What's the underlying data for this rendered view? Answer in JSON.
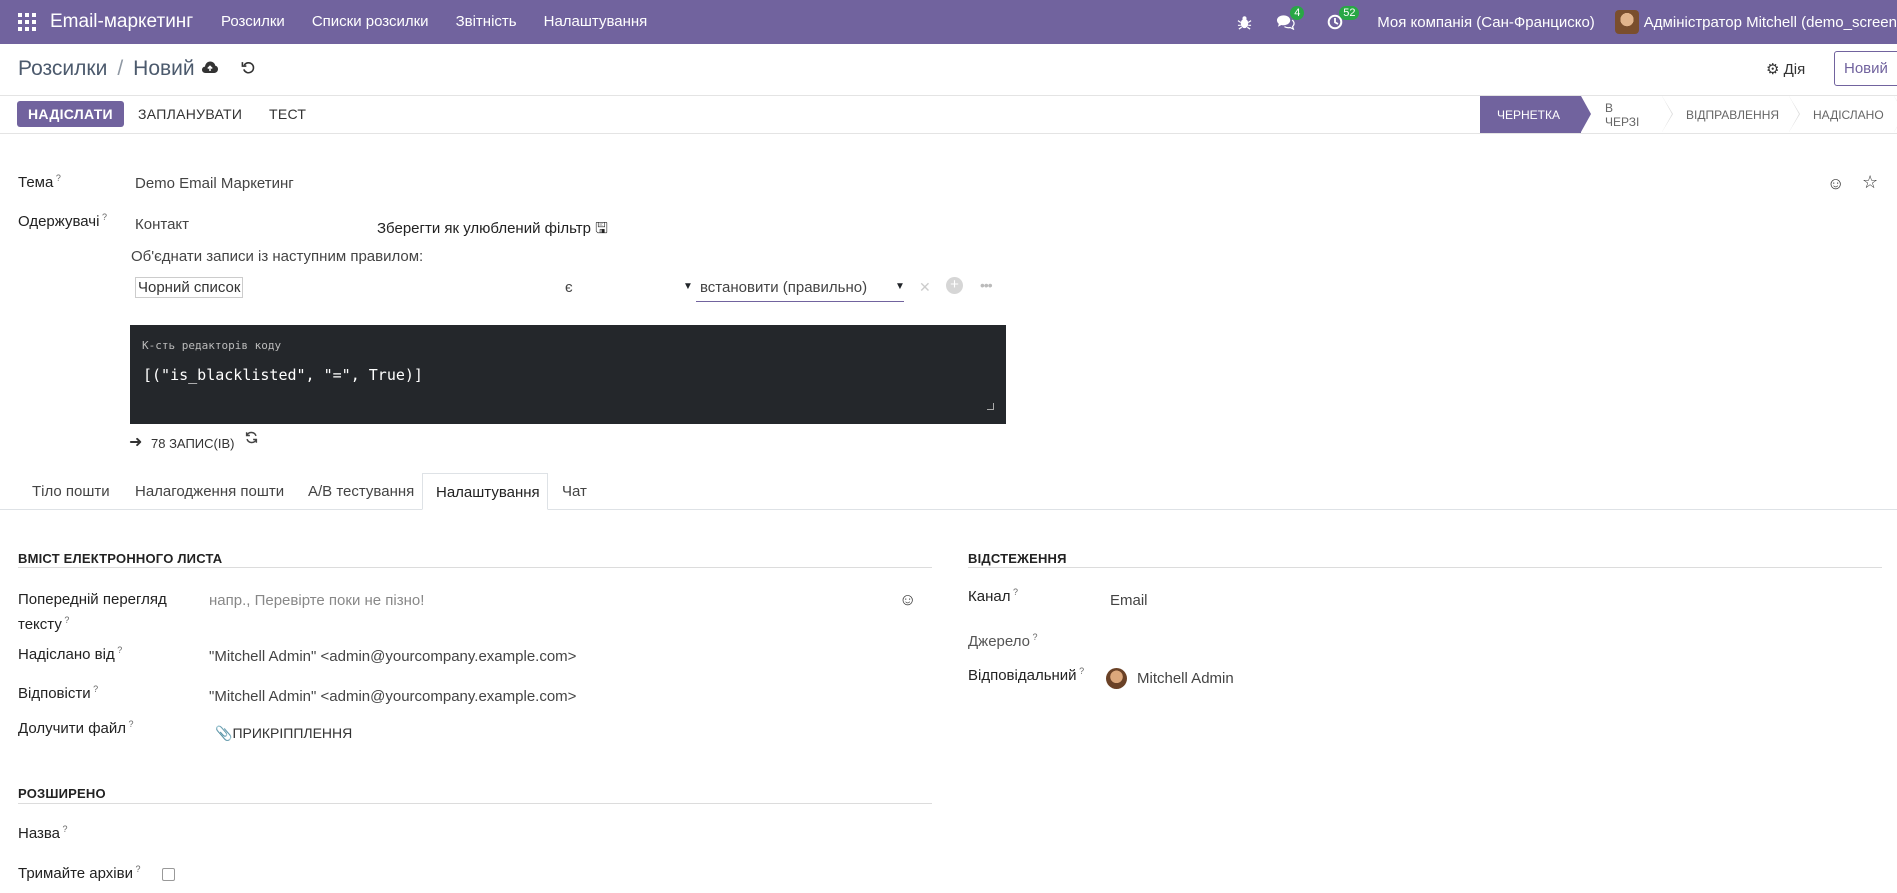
{
  "nav": {
    "app_name": "Email-маркетинг",
    "menu": [
      "Розсилки",
      "Списки розсилки",
      "Звітність",
      "Налаштування"
    ],
    "messages_badge": "4",
    "activities_badge": "52",
    "company": "Моя компанія (Сан-Франциско)",
    "user": "Адміністратор Mitchell (demo_screen"
  },
  "breadcrumb": {
    "parent": "Розсилки",
    "sep": "/",
    "current": "Новий"
  },
  "control": {
    "action": "Дія",
    "new": "Новий"
  },
  "buttons": {
    "send": "НАДІСЛАТИ",
    "schedule": "ЗАПЛАНУВАТИ",
    "test": "ТЕСТ"
  },
  "stages": [
    "ЧЕРНЕТКА",
    "В ЧЕРЗІ",
    "ВІДПРАВЛЕННЯ",
    "НАДІСЛАНО"
  ],
  "form": {
    "subject_label": "Тема",
    "subject_value": "Demo Email Маркетинг",
    "recipients_label": "Одержувачі",
    "recipients_model": "Контакт",
    "save_filter": "Зберегти як улюблений фільтр",
    "rule_text": "Об'єднати записи із наступним правилом:",
    "rule_field": "Чорний список",
    "rule_operator": "є",
    "rule_value": "встановити (правильно)",
    "code_title": "К-сть редакторів коду",
    "code_value": "[(\"is_blacklisted\", \"=\", True)]",
    "records": "78 ЗАПИС(ІВ)"
  },
  "tabs": [
    "Тіло пошти",
    "Налагодження пошти",
    "A/B тестування",
    "Налаштування",
    "Чат"
  ],
  "settings": {
    "email_content_title": "ВМІСТ ЕЛЕКТРОННОГО ЛИСТА",
    "preview_label_1": "Попередній перегляд",
    "preview_label_2": "тексту",
    "preview_placeholder": "напр., Перевірте поки не пізно!",
    "sent_from_label": "Надіслано від",
    "sent_from_value": "\"Mitchell Admin\" <admin@yourcompany.example.com>",
    "reply_label": "Відповісти",
    "reply_value": "\"Mitchell Admin\" <admin@yourcompany.example.com>",
    "attach_label": "Долучити файл",
    "attach_button": "ПРИКРІППЛЕННЯ",
    "tracking_title": "ВІДСТЕЖЕННЯ",
    "channel_label": "Канал",
    "channel_value": "Email",
    "source_label": "Джерело",
    "responsible_label": "Відповідальний",
    "responsible_value": "Mitchell Admin",
    "advanced_title": "РОЗШИРЕНО",
    "name_label": "Назва",
    "keep_archives_label": "Тримайте архіви"
  },
  "colors": {
    "brand": "#71639e",
    "badge": "#28a745",
    "code_bg": "#24272b"
  }
}
